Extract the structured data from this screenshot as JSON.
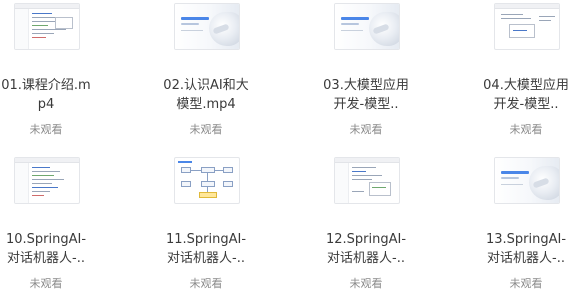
{
  "items": [
    {
      "name": "01.课程介绍.mp4",
      "status": "未观看",
      "thumb": "ide-screenshot"
    },
    {
      "name": "02.认识AI和大模型.mp4",
      "status": "未观看",
      "thumb": "slide-cover"
    },
    {
      "name": "03.大模型应用开发-模型..",
      "status": "未观看",
      "thumb": "slide-cover"
    },
    {
      "name": "04.大模型应用开发-模型..",
      "status": "未观看",
      "thumb": "ide-screenshot"
    },
    {
      "name": "10.SpringAI-对话机器人-..",
      "status": "未观看",
      "thumb": "ide-screenshot"
    },
    {
      "name": "11.SpringAI-对话机器人-..",
      "status": "未观看",
      "thumb": "flow-diagram"
    },
    {
      "name": "12.SpringAI-对话机器人-..",
      "status": "未观看",
      "thumb": "ide-screenshot"
    },
    {
      "name": "13.SpringAI-对话机器人-..",
      "status": "未观看",
      "thumb": "slide-cover"
    }
  ]
}
